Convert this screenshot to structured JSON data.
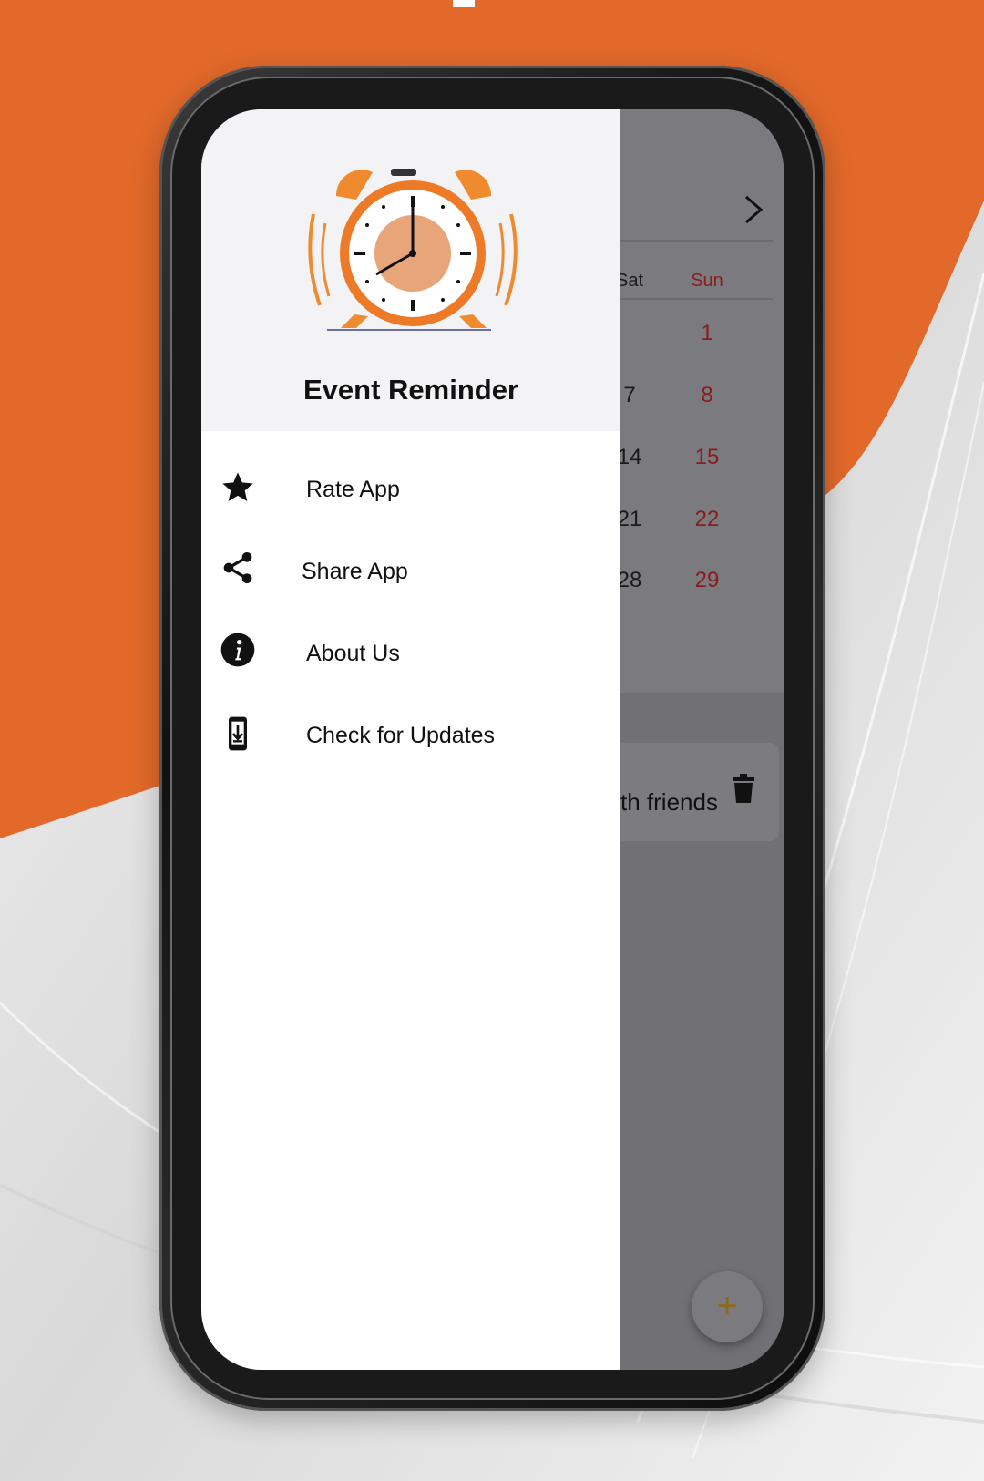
{
  "app": {
    "title": "Event Reminder"
  },
  "menu": [
    {
      "label": "Rate App",
      "icon": "star-icon"
    },
    {
      "label": "Share App",
      "icon": "share-icon"
    },
    {
      "label": "About Us",
      "icon": "info-icon"
    },
    {
      "label": "Check for Updates",
      "icon": "download-update-icon"
    }
  ],
  "calendar": {
    "day_headers": [
      "Sat",
      "Sun"
    ],
    "rows": [
      [
        "",
        "1"
      ],
      [
        "7",
        "8"
      ],
      [
        "14",
        "15"
      ],
      [
        "21",
        "22"
      ],
      [
        "28",
        "29"
      ]
    ]
  },
  "event": {
    "text": "th friends"
  },
  "fab": {
    "label": "+"
  },
  "colors": {
    "accent_orange": "#E2692A",
    "weekend_red": "#8A1C1C",
    "drawer_header_bg": "#F3F3F6"
  }
}
